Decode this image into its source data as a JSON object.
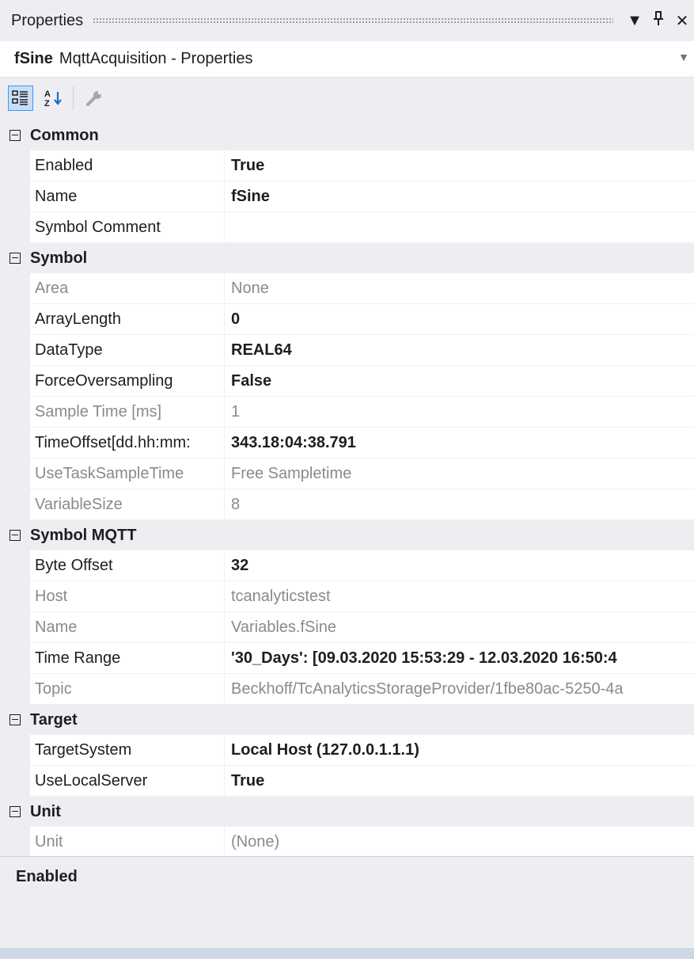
{
  "window": {
    "title": "Properties",
    "buttons": [
      "▼",
      "⊥",
      "✕"
    ]
  },
  "object": {
    "name": "fSine",
    "type": "MqttAcquisition - Properties"
  },
  "toolbar": {
    "items": [
      "categorized-icon",
      "alphabetical-icon",
      "property-pages-icon"
    ]
  },
  "categories": [
    {
      "name": "Common",
      "properties": [
        {
          "name": "Enabled",
          "value": "True",
          "bold": true,
          "readonly": false
        },
        {
          "name": "Name",
          "value": "fSine",
          "bold": true,
          "readonly": false
        },
        {
          "name": "Symbol Comment",
          "value": "",
          "bold": false,
          "readonly": false
        }
      ]
    },
    {
      "name": "Symbol",
      "properties": [
        {
          "name": "Area",
          "value": "None",
          "bold": false,
          "readonly": true
        },
        {
          "name": "ArrayLength",
          "value": "0",
          "bold": true,
          "readonly": false
        },
        {
          "name": "DataType",
          "value": "REAL64",
          "bold": true,
          "readonly": false
        },
        {
          "name": "ForceOversampling",
          "value": "False",
          "bold": true,
          "readonly": false
        },
        {
          "name": "Sample Time [ms]",
          "value": "1",
          "bold": false,
          "readonly": true
        },
        {
          "name": "TimeOffset[dd.hh:mm:",
          "value": "343.18:04:38.791",
          "bold": true,
          "readonly": false
        },
        {
          "name": "UseTaskSampleTime",
          "value": "Free Sampletime",
          "bold": false,
          "readonly": true
        },
        {
          "name": "VariableSize",
          "value": "8",
          "bold": false,
          "readonly": true
        }
      ]
    },
    {
      "name": "Symbol MQTT",
      "properties": [
        {
          "name": "Byte Offset",
          "value": "32",
          "bold": true,
          "readonly": false
        },
        {
          "name": "Host",
          "value": "tcanalyticstest",
          "bold": false,
          "readonly": true
        },
        {
          "name": "Name",
          "value": "Variables.fSine",
          "bold": false,
          "readonly": true
        },
        {
          "name": "Time Range",
          "value": "'30_Days': [09.03.2020 15:53:29 - 12.03.2020 16:50:4",
          "bold": true,
          "readonly": false
        },
        {
          "name": "Topic",
          "value": "Beckhoff/TcAnalyticsStorageProvider/1fbe80ac-5250-4a",
          "bold": false,
          "readonly": true
        }
      ]
    },
    {
      "name": "Target",
      "properties": [
        {
          "name": "TargetSystem",
          "value": "Local Host (127.0.0.1.1.1)",
          "bold": true,
          "readonly": false
        },
        {
          "name": "UseLocalServer",
          "value": "True",
          "bold": true,
          "readonly": false
        }
      ]
    },
    {
      "name": "Unit",
      "properties": [
        {
          "name": "Unit",
          "value": "(None)",
          "bold": false,
          "readonly": true
        }
      ]
    }
  ],
  "description": {
    "title": "Enabled"
  }
}
